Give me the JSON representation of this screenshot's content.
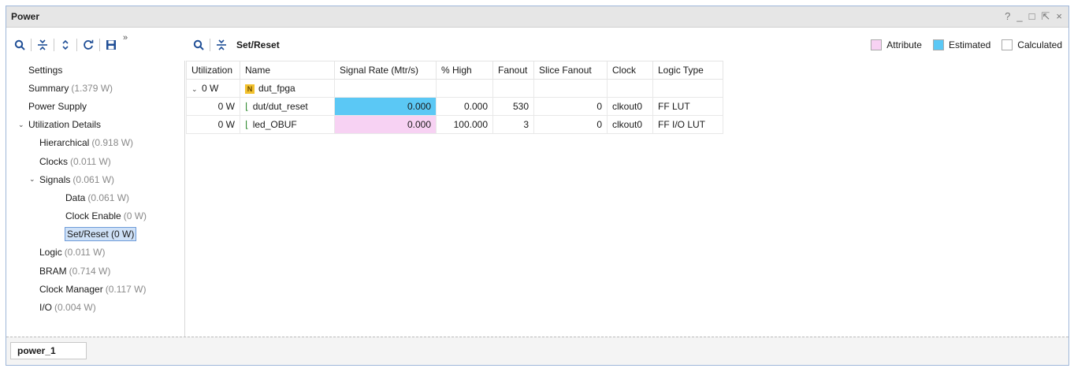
{
  "window": {
    "title": "Power",
    "controls": [
      "?",
      "_",
      "□",
      "⇱",
      "×"
    ]
  },
  "left_toolbar": {
    "more": "»"
  },
  "right_toolbar": {
    "crumb": "Set/Reset"
  },
  "legend": [
    {
      "label": "Attribute",
      "color": "#f7d2f3"
    },
    {
      "label": "Estimated",
      "color": "#5bc8f5"
    },
    {
      "label": "Calculated",
      "color": "#ffffff"
    }
  ],
  "tree": [
    {
      "label": "Settings",
      "value": ""
    },
    {
      "label": "Summary",
      "value": "(1.379 W)"
    },
    {
      "label": "Power Supply",
      "value": ""
    },
    {
      "label": "Utilization Details",
      "value": ""
    },
    {
      "label": "Hierarchical",
      "value": "(0.918 W)"
    },
    {
      "label": "Clocks",
      "value": "(0.011 W)"
    },
    {
      "label": "Signals",
      "value": "(0.061 W)"
    },
    {
      "label": "Data",
      "value": "(0.061 W)"
    },
    {
      "label": "Clock Enable",
      "value": "(0 W)"
    },
    {
      "label": "Set/Reset (0 W)",
      "value": ""
    },
    {
      "label": "Logic",
      "value": "(0.011 W)"
    },
    {
      "label": "BRAM",
      "value": "(0.714 W)"
    },
    {
      "label": "Clock Manager",
      "value": "(0.117 W)"
    },
    {
      "label": "I/O",
      "value": "(0.004 W)"
    }
  ],
  "table": {
    "headers": [
      "Utilization",
      "Name",
      "Signal Rate (Mtr/s)",
      "% High",
      "Fanout",
      "Slice Fanout",
      "Clock",
      "Logic Type"
    ],
    "rows": [
      {
        "util": "0 W",
        "name": "dut_fpga",
        "rate": "",
        "high": "",
        "fanout": "",
        "slice": "",
        "clock": "",
        "logic": ""
      },
      {
        "util": "0 W",
        "name": "dut/dut_reset",
        "rate": "0.000",
        "high": "0.000",
        "fanout": "530",
        "slice": "0",
        "clock": "clkout0",
        "logic": "FF LUT"
      },
      {
        "util": "0 W",
        "name": "led_OBUF",
        "rate": "0.000",
        "high": "100.000",
        "fanout": "3",
        "slice": "0",
        "clock": "clkout0",
        "logic": "FF I/O LUT"
      }
    ]
  },
  "footer": {
    "tab": "power_1"
  }
}
